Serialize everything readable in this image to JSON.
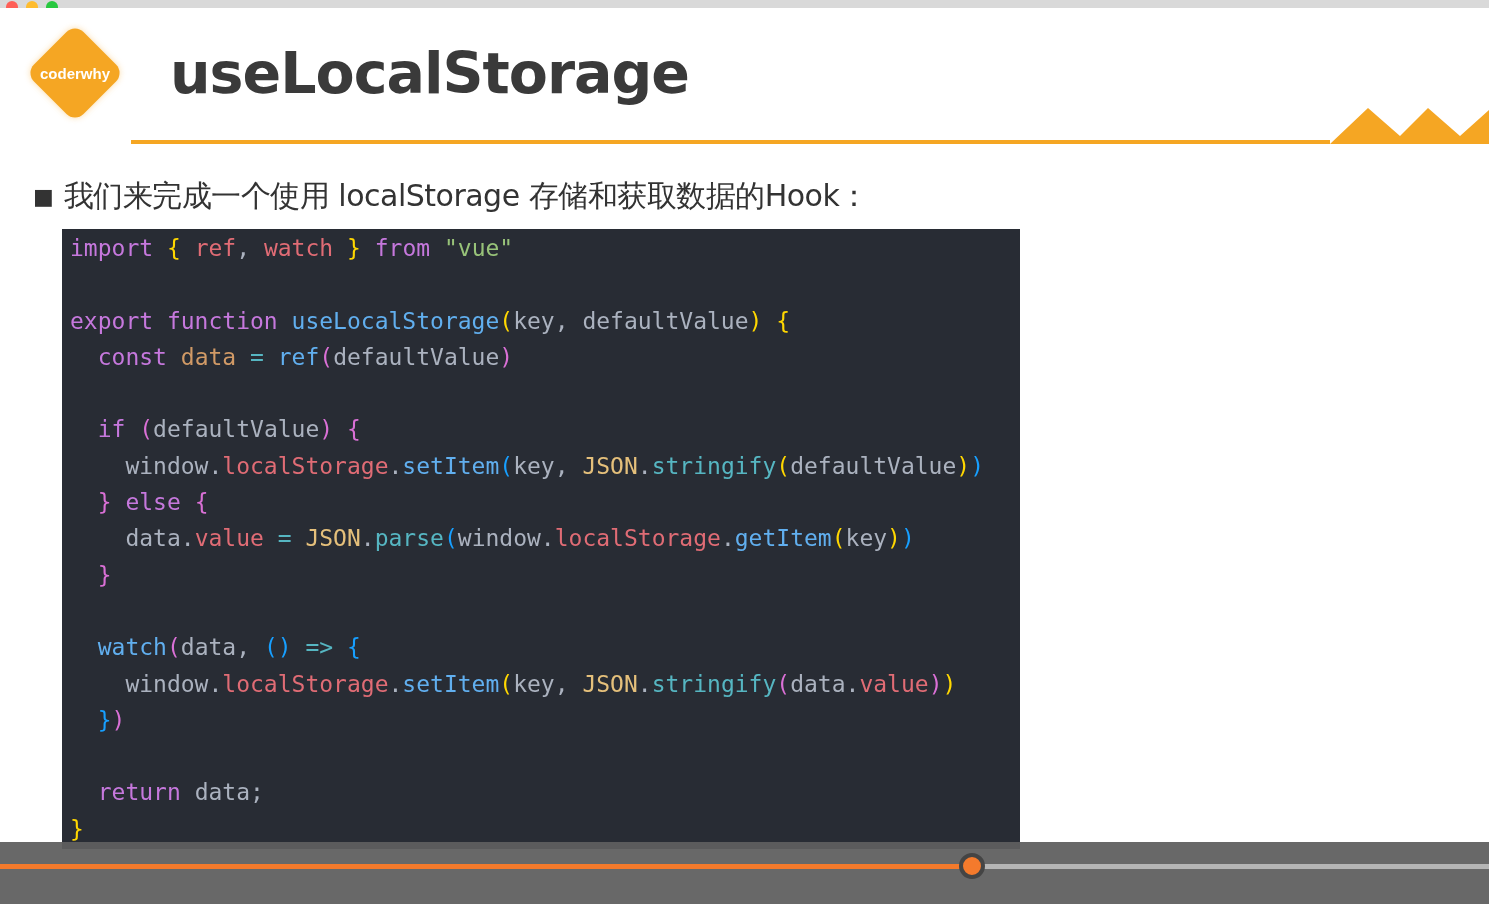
{
  "slide": {
    "logo": "coderwhy",
    "title": "useLocalStorage",
    "bullet": "■",
    "text": "我们来完成一个使用 localStorage 存储和获取数据的Hook：",
    "code": [
      {
        "kind": "code",
        "tokens": [
          {
            "kind": "kw",
            "text": "import "
          },
          {
            "kind": "b1",
            "text": "{ "
          },
          {
            "kind": "var",
            "text": "ref"
          },
          {
            "kind": "plain",
            "text": ", "
          },
          {
            "kind": "var",
            "text": "watch "
          },
          {
            "kind": "b1",
            "text": "} "
          },
          {
            "kind": "kw",
            "text": "from "
          },
          {
            "kind": "str",
            "text": "\"vue\""
          }
        ]
      },
      {
        "kind": "blank"
      },
      {
        "kind": "code",
        "tokens": [
          {
            "kind": "kw",
            "text": "export function "
          },
          {
            "kind": "fn",
            "text": "useLocalStorage"
          },
          {
            "kind": "b1",
            "text": "("
          },
          {
            "kind": "plain",
            "text": "key, defaultValue"
          },
          {
            "kind": "b1",
            "text": ") {"
          }
        ]
      },
      {
        "kind": "code",
        "tokens": [
          {
            "kind": "kw",
            "text": "  const "
          },
          {
            "kind": "num",
            "text": "data "
          },
          {
            "kind": "op",
            "text": "= "
          },
          {
            "kind": "fn",
            "text": "ref"
          },
          {
            "kind": "b2",
            "text": "("
          },
          {
            "kind": "plain",
            "text": "defaultValue"
          },
          {
            "kind": "b2",
            "text": ")"
          }
        ]
      },
      {
        "kind": "blank"
      },
      {
        "kind": "code",
        "tokens": [
          {
            "kind": "kw",
            "text": "  if "
          },
          {
            "kind": "b2",
            "text": "("
          },
          {
            "kind": "plain",
            "text": "defaultValue"
          },
          {
            "kind": "b2",
            "text": ") {"
          }
        ]
      },
      {
        "kind": "code",
        "tokens": [
          {
            "kind": "plain",
            "text": "    window."
          },
          {
            "kind": "prop",
            "text": "localStorage"
          },
          {
            "kind": "plain",
            "text": "."
          },
          {
            "kind": "fn",
            "text": "setItem"
          },
          {
            "kind": "b3",
            "text": "("
          },
          {
            "kind": "plain",
            "text": "key, "
          },
          {
            "kind": "cls",
            "text": "JSON"
          },
          {
            "kind": "plain",
            "text": "."
          },
          {
            "kind": "method",
            "text": "stringify"
          },
          {
            "kind": "b1",
            "text": "("
          },
          {
            "kind": "plain",
            "text": "defaultValue"
          },
          {
            "kind": "b1",
            "text": ")"
          },
          {
            "kind": "b3",
            "text": ")"
          }
        ]
      },
      {
        "kind": "code",
        "tokens": [
          {
            "kind": "b2",
            "text": "  } "
          },
          {
            "kind": "kw",
            "text": "else "
          },
          {
            "kind": "b2",
            "text": "{"
          }
        ]
      },
      {
        "kind": "code",
        "tokens": [
          {
            "kind": "plain",
            "text": "    data."
          },
          {
            "kind": "prop",
            "text": "value "
          },
          {
            "kind": "op",
            "text": "= "
          },
          {
            "kind": "cls",
            "text": "JSON"
          },
          {
            "kind": "plain",
            "text": "."
          },
          {
            "kind": "method",
            "text": "parse"
          },
          {
            "kind": "b3",
            "text": "("
          },
          {
            "kind": "plain",
            "text": "window."
          },
          {
            "kind": "prop",
            "text": "localStorage"
          },
          {
            "kind": "plain",
            "text": "."
          },
          {
            "kind": "fn",
            "text": "getItem"
          },
          {
            "kind": "b1",
            "text": "("
          },
          {
            "kind": "plain",
            "text": "key"
          },
          {
            "kind": "b1",
            "text": ")"
          },
          {
            "kind": "b3",
            "text": ")"
          }
        ]
      },
      {
        "kind": "code",
        "tokens": [
          {
            "kind": "b2",
            "text": "  }"
          }
        ]
      },
      {
        "kind": "blank"
      },
      {
        "kind": "code",
        "tokens": [
          {
            "kind": "fn",
            "text": "  watch"
          },
          {
            "kind": "b2",
            "text": "("
          },
          {
            "kind": "plain",
            "text": "data, "
          },
          {
            "kind": "b3",
            "text": "() "
          },
          {
            "kind": "op",
            "text": "=> "
          },
          {
            "kind": "b3",
            "text": "{"
          }
        ]
      },
      {
        "kind": "code",
        "tokens": [
          {
            "kind": "plain",
            "text": "    window."
          },
          {
            "kind": "prop",
            "text": "localStorage"
          },
          {
            "kind": "plain",
            "text": "."
          },
          {
            "kind": "fn",
            "text": "setItem"
          },
          {
            "kind": "b1",
            "text": "("
          },
          {
            "kind": "plain",
            "text": "key, "
          },
          {
            "kind": "cls",
            "text": "JSON"
          },
          {
            "kind": "plain",
            "text": "."
          },
          {
            "kind": "method",
            "text": "stringify"
          },
          {
            "kind": "b2",
            "text": "("
          },
          {
            "kind": "plain",
            "text": "data."
          },
          {
            "kind": "prop",
            "text": "value"
          },
          {
            "kind": "b2",
            "text": ")"
          },
          {
            "kind": "b1",
            "text": ")"
          }
        ]
      },
      {
        "kind": "code",
        "tokens": [
          {
            "kind": "b3",
            "text": "  }"
          },
          {
            "kind": "b2",
            "text": ")"
          }
        ]
      },
      {
        "kind": "blank"
      },
      {
        "kind": "code",
        "tokens": [
          {
            "kind": "kw",
            "text": "  return "
          },
          {
            "kind": "plain",
            "text": "data;"
          }
        ]
      },
      {
        "kind": "code",
        "tokens": [
          {
            "kind": "b1",
            "text": "}"
          }
        ]
      }
    ]
  },
  "player": {
    "progress": {
      "level": 0.653
    }
  }
}
